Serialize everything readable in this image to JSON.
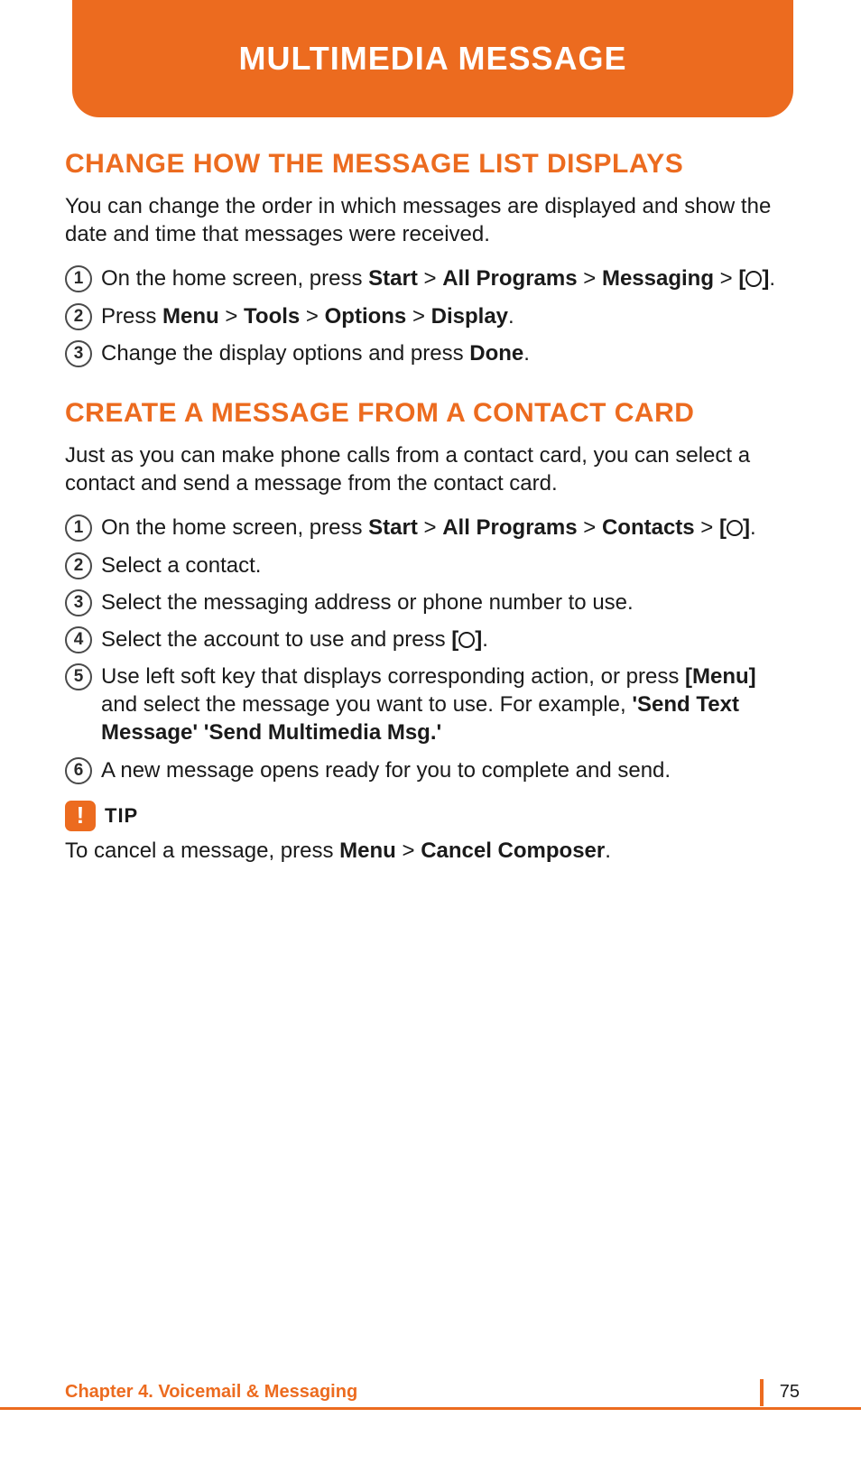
{
  "header": {
    "title": "MULTIMEDIA MESSAGE"
  },
  "section1": {
    "heading": "CHANGE HOW THE MESSAGE LIST DISPLAYS",
    "intro": "You can change the order in which messages are displayed and show the date and time that messages were received.",
    "steps": [
      {
        "num": "1",
        "pre": "On the home screen, press ",
        "b1": "Start",
        "mid1": " > ",
        "b2": "All Programs",
        "mid2": " > ",
        "b3": "Messaging",
        "mid3": " > ",
        "b4o": "[",
        "b4c": "]",
        "post": "."
      },
      {
        "num": "2",
        "pre": "Press ",
        "b1": "Menu",
        "mid1": " > ",
        "b2": "Tools",
        "mid2": " > ",
        "b3": "Options",
        "mid3": " > ",
        "b4": "Display",
        "post": "."
      },
      {
        "num": "3",
        "pre": "Change the display options and press ",
        "b1": "Done",
        "post": "."
      }
    ]
  },
  "section2": {
    "heading": "CREATE A MESSAGE FROM A CONTACT CARD",
    "intro": "Just as you can make phone calls from a contact card, you can select a contact and send a message from the contact card.",
    "steps": [
      {
        "num": "1",
        "pre": "On the home screen, press ",
        "b1": "Start",
        "mid1": " > ",
        "b2": "All Programs",
        "mid2": " > ",
        "b3": "Contacts",
        "mid3": " > ",
        "b4o": "[",
        "b4c": "]",
        "post": "."
      },
      {
        "num": "2",
        "pre": "Select a contact."
      },
      {
        "num": "3",
        "pre": "Select the messaging address or phone number to use."
      },
      {
        "num": "4",
        "pre": "Select the account to use and press ",
        "b4o": "[",
        "b4c": "]",
        "post": "."
      },
      {
        "num": "5",
        "pre": "Use left soft key that displays corresponding action, or press ",
        "b1": "[Menu]",
        "mid1": " and select the message you want to use. For example, ",
        "b2": "'Send Text Message' 'Send Multimedia Msg.'"
      },
      {
        "num": "6",
        "pre": "A new message opens ready for you to complete and send."
      }
    ]
  },
  "tip": {
    "icon": "!",
    "label": "TIP",
    "pre": "To cancel a message, press ",
    "b1": "Menu",
    "mid": " > ",
    "b2": "Cancel Composer",
    "post": "."
  },
  "footer": {
    "chapter": "Chapter 4. Voicemail & Messaging",
    "page": "75"
  }
}
